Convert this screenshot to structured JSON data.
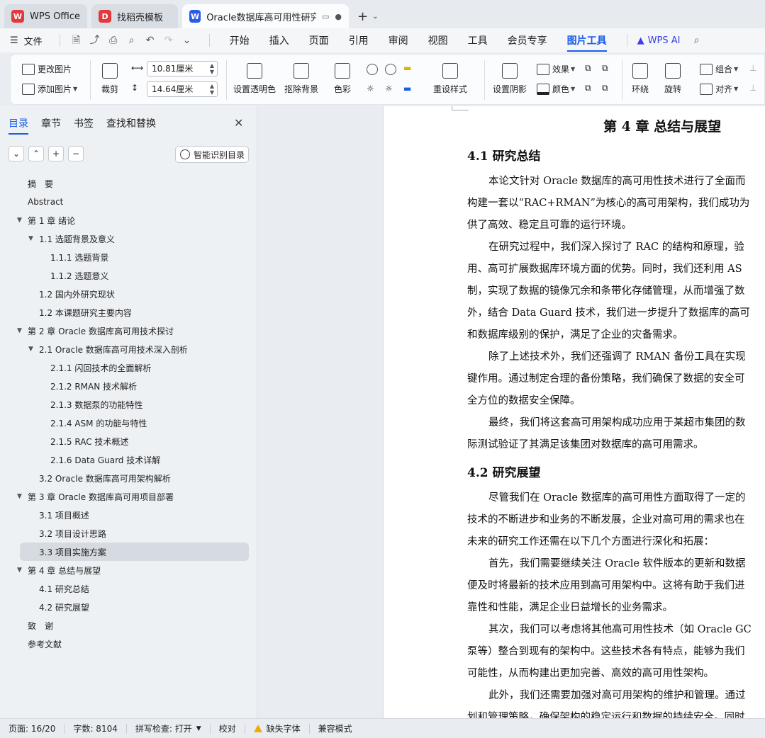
{
  "tabs": [
    {
      "label": "WPS Office",
      "logo": "W",
      "color": "#e4393c"
    },
    {
      "label": "找稻壳模板",
      "logo": "D",
      "color": "#e4393c"
    },
    {
      "label": "Oracle数据库高可用性研究与",
      "logo": "W",
      "color": "#2b5ce6"
    }
  ],
  "menu": {
    "file": "文件",
    "tabs": [
      "开始",
      "插入",
      "页面",
      "引用",
      "审阅",
      "视图",
      "工具",
      "会员专享",
      "图片工具"
    ],
    "active_tab": "图片工具",
    "ai": "WPS AI"
  },
  "ribbon": {
    "change_pic": "更改图片",
    "add_pic": "添加图片",
    "crop": "裁剪",
    "width": "10.81厘米",
    "height": "14.64厘米",
    "set_transparent": "设置透明色",
    "remove_bg": "抠除背景",
    "color": "色彩",
    "reset_style": "重设样式",
    "set_shadow": "设置阴影",
    "effect": "效果",
    "color2": "颜色",
    "wrap": "环绕",
    "rotate": "旋转",
    "group": "组合",
    "align": "对齐"
  },
  "nav": {
    "tabs": [
      "目录",
      "章节",
      "书签",
      "查找和替换"
    ],
    "active_tab": "目录",
    "smart_btn": "智能识别目录",
    "toc": [
      {
        "label": "摘　要",
        "level": 0,
        "arrow": false
      },
      {
        "label": "Abstract",
        "level": 0,
        "arrow": false
      },
      {
        "label": "第 1 章  绪论",
        "level": 0,
        "arrow": true
      },
      {
        "label": "1.1  选题背景及意义",
        "level": 1,
        "arrow": true
      },
      {
        "label": "1.1.1  选题背景",
        "level": 2,
        "arrow": false
      },
      {
        "label": "1.1.2  选题意义",
        "level": 2,
        "arrow": false
      },
      {
        "label": "1.2  国内外研究现状",
        "level": 1,
        "arrow": false
      },
      {
        "label": "1.2 本课题研究主要内容",
        "level": 1,
        "arrow": false
      },
      {
        "label": "第 2 章  Oracle 数据库高可用技术探讨",
        "level": 0,
        "arrow": true
      },
      {
        "label": "2.1 Oracle 数据库高可用技术深入剖析",
        "level": 1,
        "arrow": true
      },
      {
        "label": "2.1.1  闪回技术的全面解析",
        "level": 2,
        "arrow": false
      },
      {
        "label": "2.1.2 RMAN 技术解析",
        "level": 2,
        "arrow": false
      },
      {
        "label": "2.1.3  数据泵的功能特性",
        "level": 2,
        "arrow": false
      },
      {
        "label": "2.1.4 ASM 的功能与特性",
        "level": 2,
        "arrow": false
      },
      {
        "label": "2.1.5 RAC 技术概述",
        "level": 2,
        "arrow": false
      },
      {
        "label": "2.1.6 Data Guard 技术详解",
        "level": 2,
        "arrow": false
      },
      {
        "label": "3.2 Oracle 数据库高可用架构解析",
        "level": 1,
        "arrow": false
      },
      {
        "label": "第 3 章  Oracle 数据库高可用项目部署",
        "level": 0,
        "arrow": true
      },
      {
        "label": "3.1  项目概述",
        "level": 1,
        "arrow": false
      },
      {
        "label": "3.2  项目设计思路",
        "level": 1,
        "arrow": false
      },
      {
        "label": "3.3  项目实施方案",
        "level": 1,
        "arrow": false,
        "selected": true
      },
      {
        "label": "第 4 章  总结与展望",
        "level": 0,
        "arrow": true
      },
      {
        "label": "4.1  研究总结",
        "level": 1,
        "arrow": false
      },
      {
        "label": "4.2  研究展望",
        "level": 1,
        "arrow": false
      },
      {
        "label": "致　谢",
        "level": 0,
        "arrow": false
      },
      {
        "label": "参考文献",
        "level": 0,
        "arrow": false
      }
    ]
  },
  "doc": {
    "chapter": "第 4 章  总结与展望",
    "sec1": "4.1  研究总结",
    "sec1_lines": [
      "本论文针对 Oracle 数据库的高可用性技术进行了全面而",
      "构建一套以“RAC+RMAN”为核心的高可用架构，我们成功为",
      "供了高效、稳定且可靠的运行环境。",
      "在研究过程中，我们深入探讨了 RAC 的结构和原理，验",
      "用、高可扩展数据库环境方面的优势。同时，我们还利用 AS",
      "制，实现了数据的镜像冗余和条带化存储管理，从而增强了数",
      "外，结合 Data Guard 技术，我们进一步提升了数据库的高可",
      "和数据库级别的保护，满足了企业的灾备需求。",
      "除了上述技术外，我们还强调了 RMAN 备份工具在实现",
      "键作用。通过制定合理的备份策略，我们确保了数据的安全可",
      "全方位的数据安全保障。",
      "最终，我们将这套高可用架构成功应用于某超市集团的数",
      "际测试验证了其满足该集团对数据库的高可用需求。"
    ],
    "sec2": "4.2  研究展望",
    "sec2_lines": [
      "尽管我们在 Oracle 数据库的高可用性方面取得了一定的",
      "技术的不断进步和业务的不断发展，企业对高可用的需求也在",
      "未来的研究工作还需在以下几个方面进行深化和拓展：",
      "首先，我们需要继续关注 Oracle 软件版本的更新和数据",
      "便及时将最新的技术应用到高可用架构中。这将有助于我们进",
      "靠性和性能，满足企业日益增长的业务需求。",
      "其次，我们可以考虑将其他高可用性技术（如 Oracle GC",
      "泵等）整合到现有的架构中。这些技术各有特点，能够为我们",
      "可能性，从而构建出更加完善、高效的高可用性架构。",
      "此外，我们还需要加强对高可用架构的维护和管理。通过",
      "划和管理策略，确保架构的稳定运行和数据的持续安全。同时"
    ]
  },
  "status": {
    "page": "页面: 16/20",
    "words": "字数: 8104",
    "spell": "拼写检查: 打开",
    "proof": "校对",
    "missing_font": "缺失字体",
    "compat": "兼容模式"
  }
}
